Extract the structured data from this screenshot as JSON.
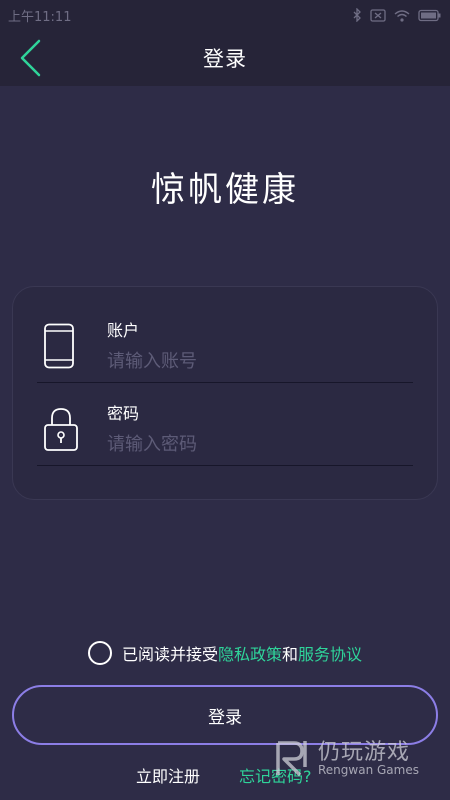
{
  "status_bar": {
    "time": "上午11:11"
  },
  "header": {
    "title": "登录",
    "back_icon": "chevron-left-icon"
  },
  "app_title": "惊帆健康",
  "form": {
    "account": {
      "label": "账户",
      "placeholder": "请输入账号",
      "icon": "phone-icon"
    },
    "password": {
      "label": "密码",
      "placeholder": "请输入密码",
      "icon": "lock-icon"
    }
  },
  "agreement": {
    "prefix": "已阅读并接受",
    "privacy_link": "隐私政策",
    "connector": "和",
    "terms_link": "服务协议"
  },
  "login_button": "登录",
  "register_link": "立即注册",
  "forgot_link": "忘记密码?",
  "watermark": {
    "cn": "仍玩游戏",
    "en": "Rengwan Games"
  },
  "colors": {
    "background": "#2e2c47",
    "header_bg": "#262438",
    "accent_green": "#2fd49a",
    "button_border": "#8c7ee6"
  }
}
